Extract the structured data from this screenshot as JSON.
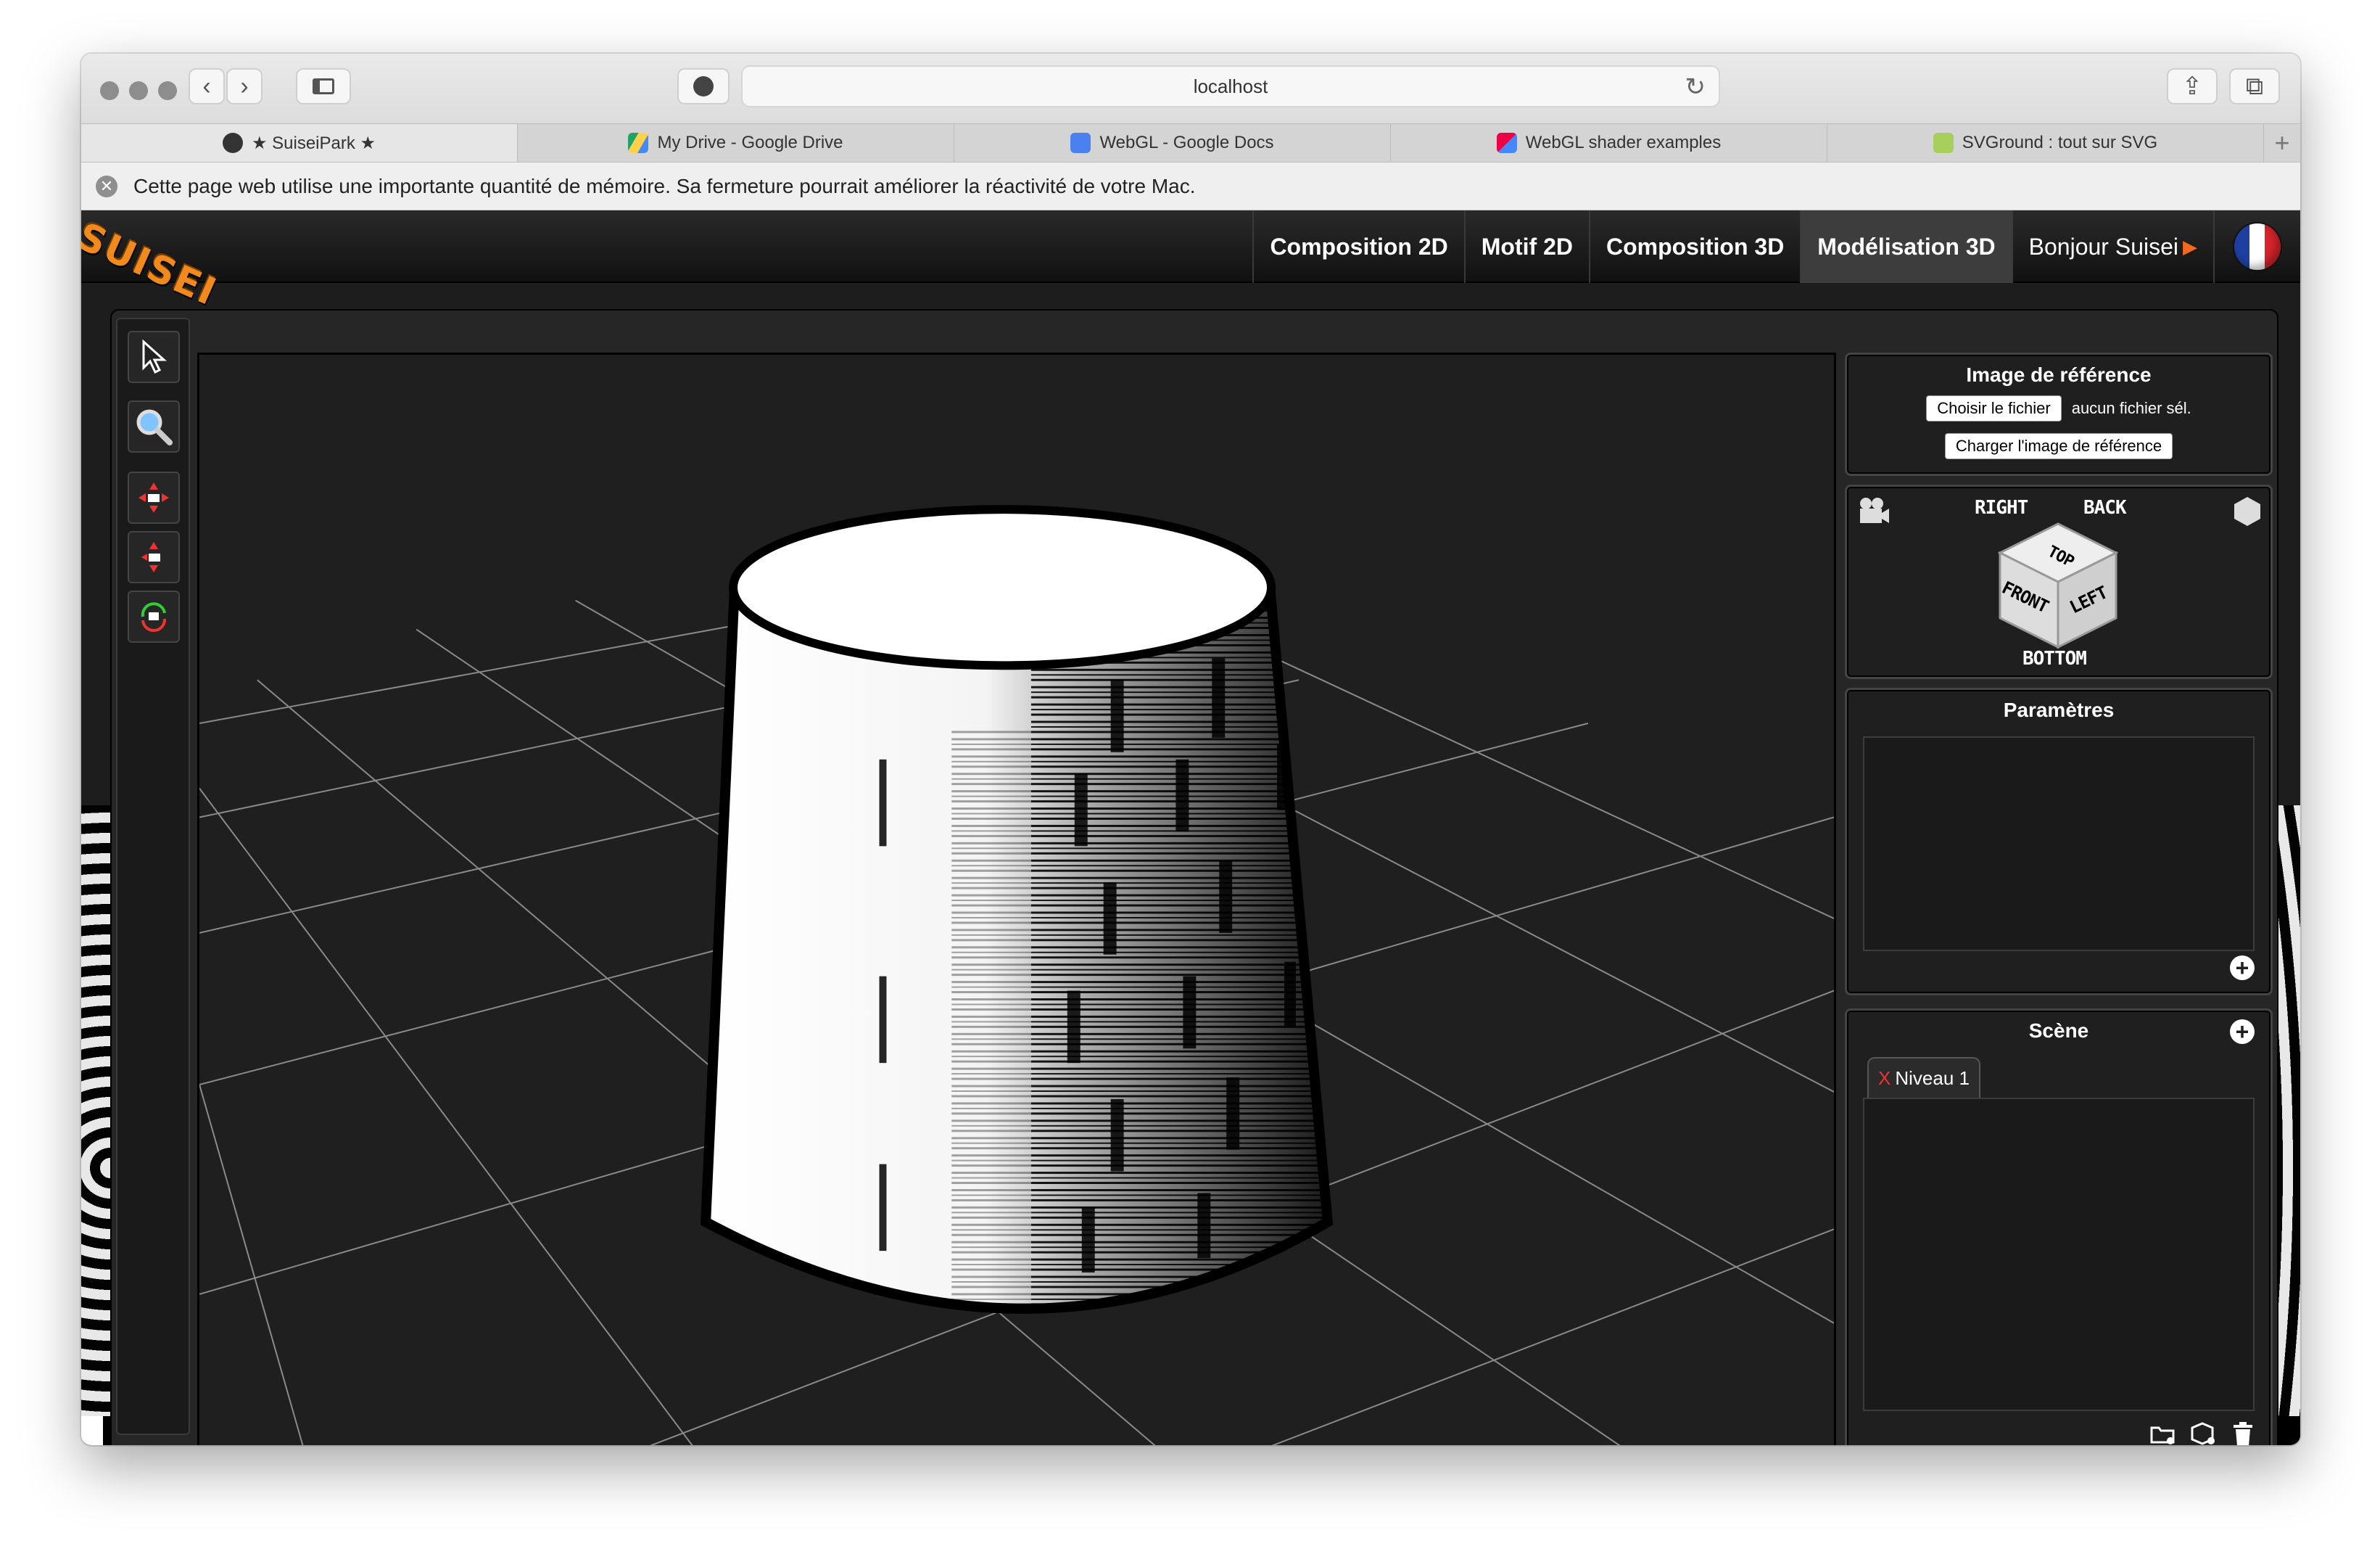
{
  "browser": {
    "url": "localhost",
    "tabs": [
      {
        "label": "★ SuiseiPark ★",
        "active": true
      },
      {
        "label": "My Drive - Google Drive",
        "active": false
      },
      {
        "label": "WebGL - Google Docs",
        "active": false
      },
      {
        "label": "WebGL shader examples",
        "active": false
      },
      {
        "label": "SVGround : tout sur SVG",
        "active": false
      }
    ],
    "new_tab_label": "+",
    "notice": "Cette page web utilise une importante quantité de mémoire. Sa fermeture pourrait améliorer la réactivité de votre Mac."
  },
  "app": {
    "logo": "SUISEI",
    "nav": {
      "items": [
        "Composition 2D",
        "Motif 2D",
        "Composition 3D",
        "Modélisation 3D"
      ],
      "active": "Modélisation 3D",
      "user": "Bonjour Suisei"
    },
    "reference_panel": {
      "title": "Image de référence",
      "choose_file_label": "Choisir le fichier",
      "file_status": "aucun fichier sél.",
      "load_label": "Charger l'image de référence"
    },
    "view_cube": {
      "right": "RIGHT",
      "back": "BACK",
      "top": "TOP",
      "front": "FRONT",
      "left": "LEFT",
      "bottom": "BOTTOM"
    },
    "params_panel": {
      "title": "Paramètres"
    },
    "scene_panel": {
      "title": "Scène",
      "tab_close": "X",
      "tab_label": "Niveau 1"
    },
    "colors": {
      "accent_orange": "#f06a22",
      "panel_bg": "#1f1f1f",
      "viewport_bg": "#1f1f1f"
    }
  }
}
